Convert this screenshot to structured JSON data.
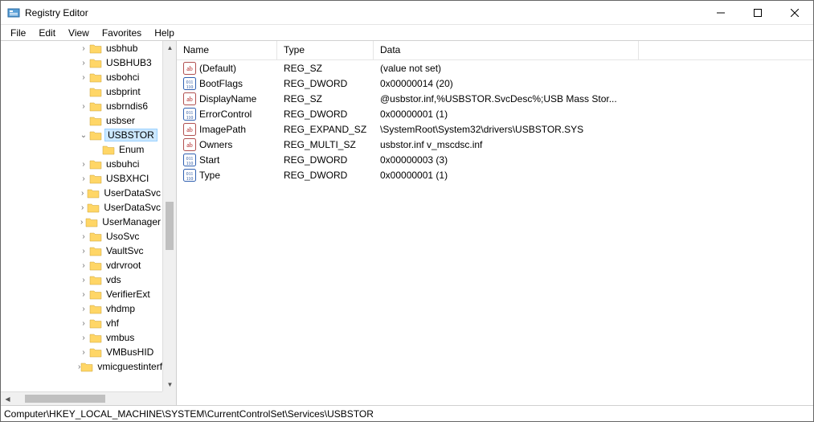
{
  "window": {
    "title": "Registry Editor"
  },
  "menu": {
    "file": "File",
    "edit": "Edit",
    "view": "View",
    "favorites": "Favorites",
    "help": "Help"
  },
  "tree": {
    "items": [
      {
        "indent": 6,
        "exp": ">",
        "label": "usbhub",
        "sel": false
      },
      {
        "indent": 6,
        "exp": ">",
        "label": "USBHUB3",
        "sel": false
      },
      {
        "indent": 6,
        "exp": ">",
        "label": "usbohci",
        "sel": false
      },
      {
        "indent": 6,
        "exp": "",
        "label": "usbprint",
        "sel": false
      },
      {
        "indent": 6,
        "exp": ">",
        "label": "usbrndis6",
        "sel": false
      },
      {
        "indent": 6,
        "exp": "",
        "label": "usbser",
        "sel": false
      },
      {
        "indent": 6,
        "exp": "v",
        "label": "USBSTOR",
        "sel": true
      },
      {
        "indent": 7,
        "exp": "",
        "label": "Enum",
        "sel": false
      },
      {
        "indent": 6,
        "exp": ">",
        "label": "usbuhci",
        "sel": false
      },
      {
        "indent": 6,
        "exp": ">",
        "label": "USBXHCI",
        "sel": false
      },
      {
        "indent": 6,
        "exp": ">",
        "label": "UserDataSvc",
        "sel": false
      },
      {
        "indent": 6,
        "exp": ">",
        "label": "UserDataSvc",
        "sel": false
      },
      {
        "indent": 6,
        "exp": ">",
        "label": "UserManager",
        "sel": false
      },
      {
        "indent": 6,
        "exp": ">",
        "label": "UsoSvc",
        "sel": false
      },
      {
        "indent": 6,
        "exp": ">",
        "label": "VaultSvc",
        "sel": false
      },
      {
        "indent": 6,
        "exp": ">",
        "label": "vdrvroot",
        "sel": false
      },
      {
        "indent": 6,
        "exp": ">",
        "label": "vds",
        "sel": false
      },
      {
        "indent": 6,
        "exp": ">",
        "label": "VerifierExt",
        "sel": false
      },
      {
        "indent": 6,
        "exp": ">",
        "label": "vhdmp",
        "sel": false
      },
      {
        "indent": 6,
        "exp": ">",
        "label": "vhf",
        "sel": false
      },
      {
        "indent": 6,
        "exp": ">",
        "label": "vmbus",
        "sel": false
      },
      {
        "indent": 6,
        "exp": ">",
        "label": "VMBusHID",
        "sel": false
      },
      {
        "indent": 6,
        "exp": ">",
        "label": "vmicguestinterface",
        "sel": false
      }
    ]
  },
  "list": {
    "columns": {
      "name": "Name",
      "type": "Type",
      "data": "Data"
    },
    "rows": [
      {
        "icon": "sz",
        "name": "(Default)",
        "type": "REG_SZ",
        "data": "(value not set)"
      },
      {
        "icon": "bin",
        "name": "BootFlags",
        "type": "REG_DWORD",
        "data": "0x00000014 (20)"
      },
      {
        "icon": "sz",
        "name": "DisplayName",
        "type": "REG_SZ",
        "data": "@usbstor.inf,%USBSTOR.SvcDesc%;USB Mass Stor..."
      },
      {
        "icon": "bin",
        "name": "ErrorControl",
        "type": "REG_DWORD",
        "data": "0x00000001 (1)"
      },
      {
        "icon": "sz",
        "name": "ImagePath",
        "type": "REG_EXPAND_SZ",
        "data": "\\SystemRoot\\System32\\drivers\\USBSTOR.SYS"
      },
      {
        "icon": "sz",
        "name": "Owners",
        "type": "REG_MULTI_SZ",
        "data": "usbstor.inf v_mscdsc.inf"
      },
      {
        "icon": "bin",
        "name": "Start",
        "type": "REG_DWORD",
        "data": "0x00000003 (3)"
      },
      {
        "icon": "bin",
        "name": "Type",
        "type": "REG_DWORD",
        "data": "0x00000001 (1)"
      }
    ]
  },
  "statusbar": {
    "path": "Computer\\HKEY_LOCAL_MACHINE\\SYSTEM\\CurrentControlSet\\Services\\USBSTOR"
  }
}
